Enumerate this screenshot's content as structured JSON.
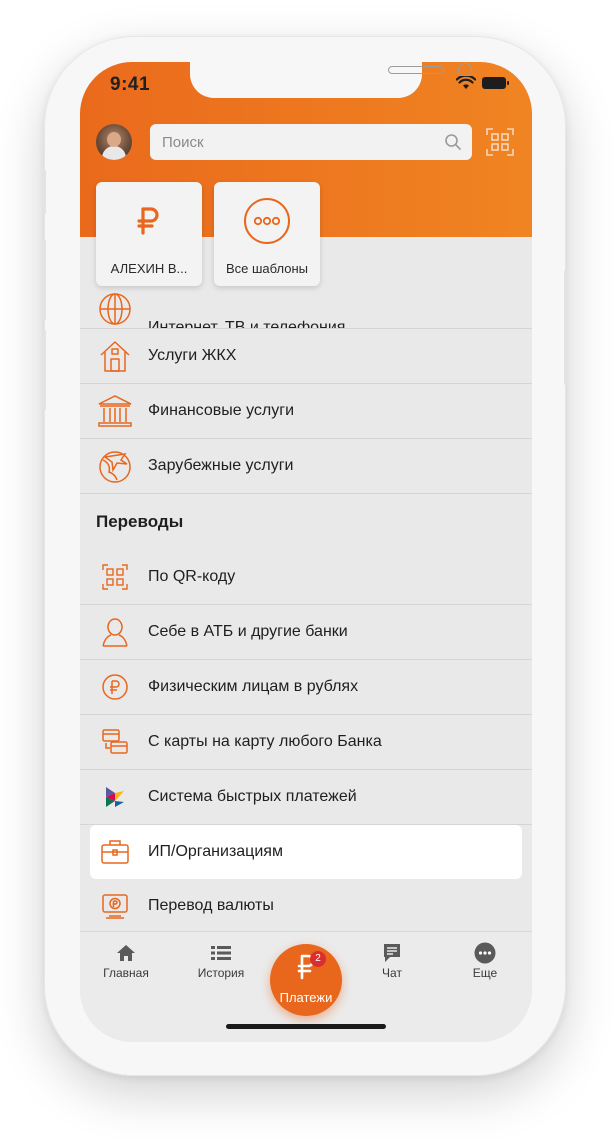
{
  "status_bar": {
    "time": "9:41"
  },
  "header": {
    "search": {
      "placeholder": "Поиск",
      "value": ""
    },
    "avatar_icon": "user-avatar-icon",
    "qr_icon": "qr-scan-icon"
  },
  "quick_cards": [
    {
      "label": "АЛЕХИН В...",
      "icon": "ruble-icon"
    },
    {
      "label": "Все шаблоны",
      "icon": "more-dots-icon"
    }
  ],
  "payments": {
    "partial_item": {
      "label": "Интернет, ТВ и телефония",
      "icon": "globe-icon"
    },
    "items": [
      {
        "label": "Услуги ЖКХ",
        "icon": "house-icon"
      },
      {
        "label": "Финансовые услуги",
        "icon": "bank-icon"
      },
      {
        "label": "Зарубежные услуги",
        "icon": "plane-globe-icon"
      }
    ]
  },
  "transfers": {
    "title": "Переводы",
    "items": [
      {
        "label": "По QR-коду",
        "icon": "qr-icon"
      },
      {
        "label": "Себе в АТБ и другие банки",
        "icon": "person-icon"
      },
      {
        "label": "Физическим лицам в рублях",
        "icon": "ruble-coin-icon"
      },
      {
        "label": "С карты на карту любого Банка",
        "icon": "cards-icon"
      },
      {
        "label": "Система быстрых платежей",
        "icon": "sbp-logo-icon"
      },
      {
        "label": "ИП/Организациям",
        "icon": "briefcase-icon",
        "selected": true
      },
      {
        "label": "Перевод валюты",
        "icon": "currency-icon"
      }
    ]
  },
  "tabbar": {
    "tabs": [
      {
        "label": "Главная",
        "icon": "home-icon"
      },
      {
        "label": "История",
        "icon": "list-icon"
      },
      {
        "label": "Платежи",
        "icon": "ruble-icon",
        "badge": "2",
        "active": true
      },
      {
        "label": "Чат",
        "icon": "chat-icon"
      },
      {
        "label": "Еще",
        "icon": "more-icon"
      }
    ]
  },
  "colors": {
    "accent": "#E8671D",
    "header_gradient_end": "#F08422",
    "badge": "#D9302F"
  }
}
